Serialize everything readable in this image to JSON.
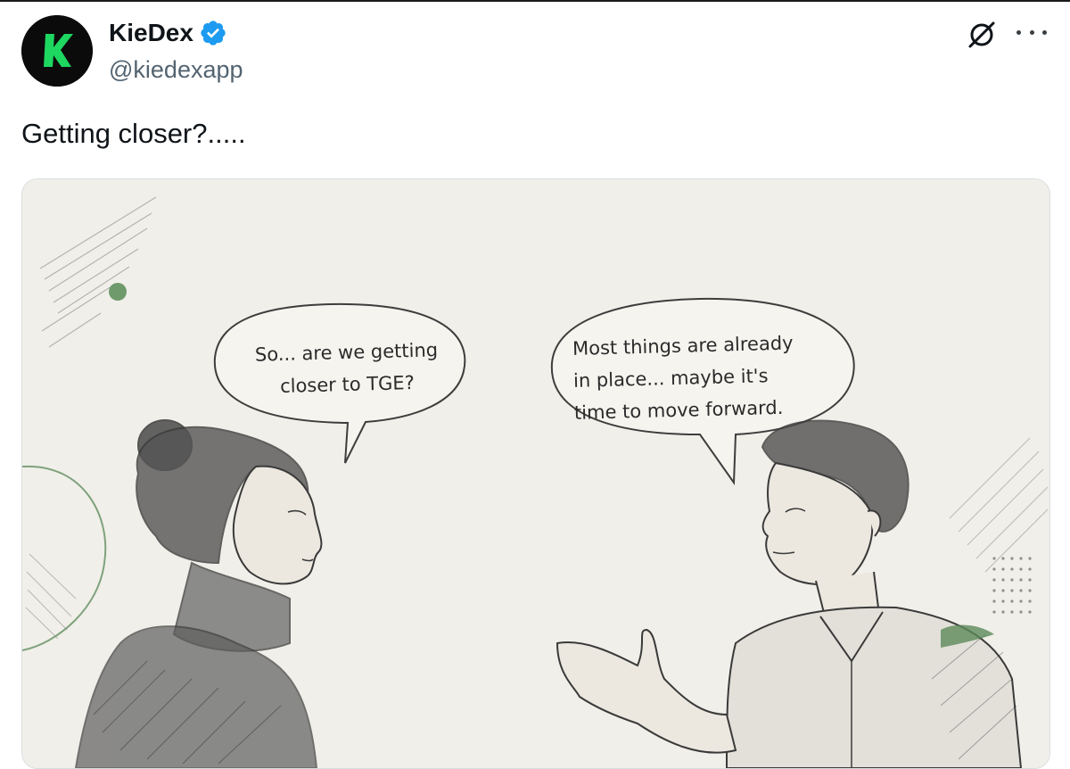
{
  "tweet": {
    "author_name": "KieDex",
    "handle": "@kiedexapp",
    "text": "Getting closer?.....",
    "avatar_letter": "K"
  },
  "header_actions": {
    "grok_icon": "grok-icon",
    "more_icon": "more-horizontal-icon"
  },
  "media": {
    "bubble_left": {
      "line1": "So... are we getting",
      "line2": "closer to TGE?"
    },
    "bubble_right": {
      "line1": "Most things are already",
      "line2": "in place... maybe it's",
      "line3": "time to move forward."
    }
  },
  "colors": {
    "verified_blue": "#1d9bf0",
    "avatar_green": "#1ed760",
    "handle_gray": "#536471",
    "paper": "#f1efe9",
    "accent_green": "#6e9a6c"
  }
}
